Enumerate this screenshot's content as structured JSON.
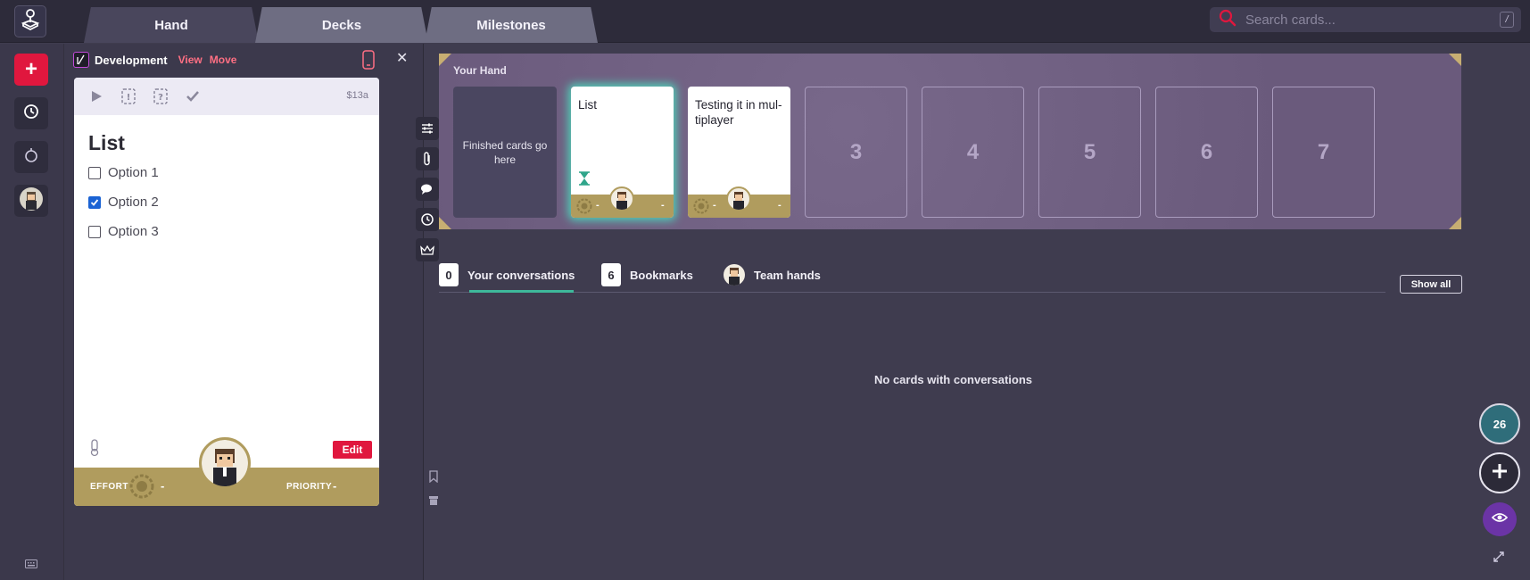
{
  "tabs": [
    {
      "label": "Hand",
      "active": true
    },
    {
      "label": "Decks",
      "active": false
    },
    {
      "label": "Milestones",
      "active": false
    }
  ],
  "search": {
    "placeholder": "Search cards...",
    "shortcut": "/"
  },
  "panel": {
    "deck_name": "Development",
    "view_link": "View",
    "move_link": "Move",
    "card": {
      "id": "$13a",
      "title": "List",
      "options": [
        {
          "label": "Option 1",
          "checked": false
        },
        {
          "label": "Option 2",
          "checked": true
        },
        {
          "label": "Option 3",
          "checked": false
        }
      ],
      "edit_label": "Edit",
      "effort_label": "EFFORT",
      "effort_value": "-",
      "priority_label": "PRIORITY",
      "priority_value": "-"
    }
  },
  "hand": {
    "title": "Your Hand",
    "finished_placeholder": "Finished cards go here",
    "cards": [
      {
        "title": "List",
        "effort": "-",
        "priority": "-",
        "active": true
      },
      {
        "title": "Testing it in mul-tiplayer",
        "effort": "-",
        "priority": "-",
        "active": false
      }
    ],
    "empty_slots": [
      "3",
      "4",
      "5",
      "6",
      "7"
    ]
  },
  "conversations": {
    "tabs": [
      {
        "count": "0",
        "label": "Your conversations",
        "active": true
      },
      {
        "count": "6",
        "label": "Bookmarks",
        "active": false
      },
      {
        "label": "Team hands",
        "active": false
      }
    ],
    "show_all": "Show all",
    "empty_message": "No cards with conversations"
  },
  "user_level": "26",
  "colors": {
    "accent_red": "#e0173e",
    "gold": "#b09c5e",
    "hand_purple": "#6f5f80",
    "active_teal": "#3eb89b",
    "eye_purple": "#6b34a6"
  },
  "icons": [
    "joystick-icon",
    "search-icon",
    "plus-icon",
    "history-icon",
    "drop-icon",
    "keyboard-icon",
    "phone-icon",
    "close-icon",
    "play-icon",
    "alert-icon",
    "question-icon",
    "check-icon",
    "thermometer-icon",
    "sliders-icon",
    "paperclip-icon",
    "comments-icon",
    "crown-icon",
    "bookmark-icon",
    "archive-icon",
    "hourglass-icon",
    "eye-icon",
    "expand-icon"
  ]
}
